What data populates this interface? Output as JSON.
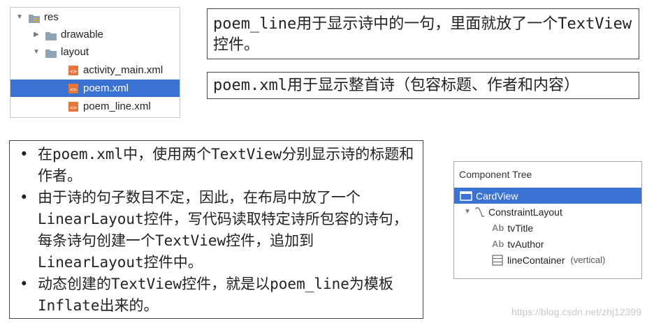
{
  "project_tree": {
    "items": [
      {
        "label": "res"
      },
      {
        "label": "drawable"
      },
      {
        "label": "layout"
      },
      {
        "label": "activity_main.xml"
      },
      {
        "label": "poem.xml"
      },
      {
        "label": "poem_line.xml"
      }
    ]
  },
  "notes": {
    "poem_line_desc": "poem_line用于显示诗中的一句，里面就放了一个TextView控件。",
    "poem_xml_desc": "poem.xml用于显示整首诗（包容标题、作者和内容）",
    "bullets": [
      "在poem.xml中，使用两个TextView分别显示诗的标题和作者。",
      "由于诗的句子数目不定，因此，在布局中放了一个LinearLayout控件，写代码读取特定诗所包容的诗句，每条诗句创建一个TextView控件，追加到LinearLayout控件中。",
      "动态创建的TextView控件，就是以poem_line为模板Inflate出来的。"
    ],
    "bullet_glyph": "•"
  },
  "component_tree": {
    "title": "Component Tree",
    "items": [
      {
        "label": "CardView"
      },
      {
        "label": "ConstraintLayout"
      },
      {
        "label": "tvTitle",
        "prefix": "Ab"
      },
      {
        "label": "tvAuthor",
        "prefix": "Ab"
      },
      {
        "label": "lineContainer",
        "note": "(vertical)"
      }
    ]
  },
  "watermark": "https://blog.csdn.net/zhj12399",
  "colors": {
    "selection": "#3b73d4",
    "folder": "#8ea3b3",
    "xml_icon": "#e8763a"
  }
}
